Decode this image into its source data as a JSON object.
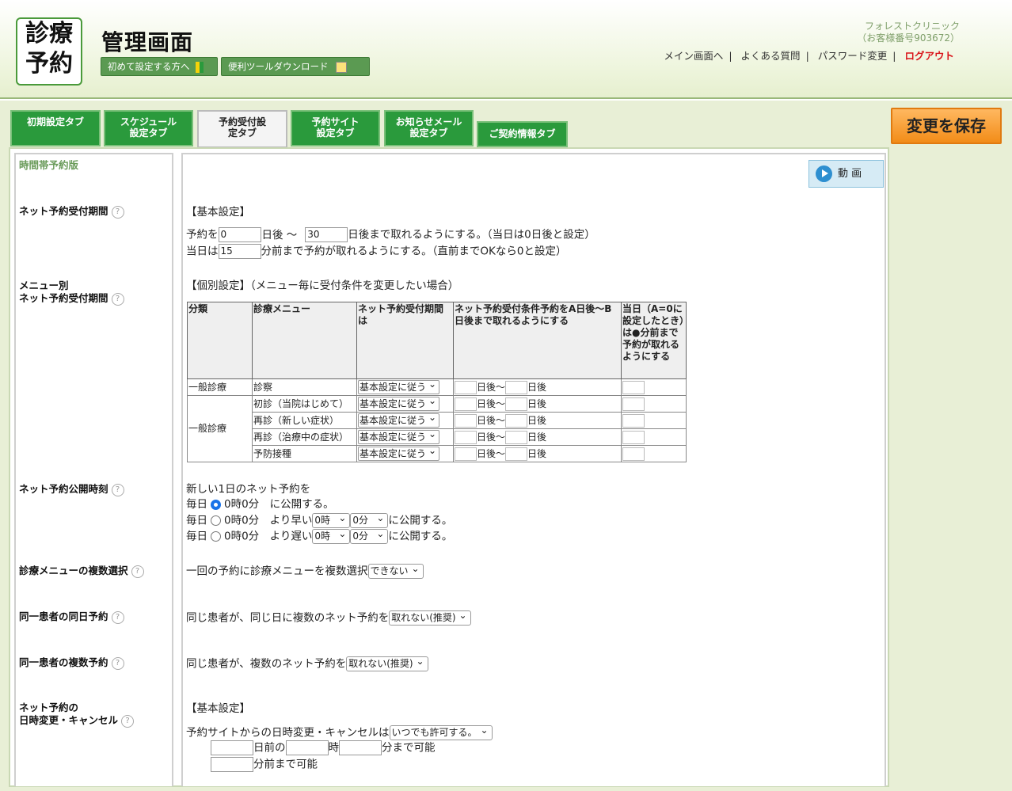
{
  "header": {
    "logo_text_1": "診療",
    "logo_text_2": "予約",
    "title": "管理画面",
    "btn_first": "初めて設定する方へ",
    "btn_tools": "便利ツールダウンロード",
    "clinic_name": "フォレストクリニック",
    "customer_no": "（お客様番号903672）",
    "link_main": "メイン画面へ",
    "link_faq": "よくある質問",
    "link_password": "パスワード変更",
    "link_logout": "ログアウト",
    "sep": "|"
  },
  "tabs": [
    {
      "label": "初期設定タブ"
    },
    {
      "label": "スケジュール設定タブ"
    },
    {
      "label": "予約受付設定タブ"
    },
    {
      "label": "予約サイト設定タブ"
    },
    {
      "label": "お知らせメール設定タブ"
    },
    {
      "label": "ご契約情報タブ"
    }
  ],
  "save_label": "変更を保存",
  "video_label": "動 画",
  "left": {
    "version": "時間帯予約版",
    "net_period": "ネット予約受付期間",
    "menu_period_1": "メニュー別",
    "menu_period_2": "ネット予約受付期間",
    "publish_time": "ネット予約公開時刻",
    "multi_menu": "診療メニューの複数選択",
    "same_day": "同一患者の同日予約",
    "multiple": "同一患者の複数予約",
    "change_1": "ネット予約の",
    "change_2": "日時変更・キャンセル",
    "help": "?"
  },
  "basic": {
    "heading": "【基本設定】",
    "l1_a": "予約を",
    "l1_v1": "0",
    "l1_b": "日後 ～",
    "l1_v2": "30",
    "l1_c": "日後まで取れるようにする。（当日は0日後と設定）",
    "l2_a": "当日は",
    "l2_v": "15",
    "l2_b": "分前まで予約が取れるようにする。（直前までOKなら0と設定）"
  },
  "individual": {
    "heading": "【個別設定】（メニュー毎に受付条件を変更したい場合）",
    "th1": "分類",
    "th2": "診療メニュー",
    "th3": "ネット予約受付期間は",
    "th4": "ネット予約受付条件予約をA日後～B日後まで取れるようにする",
    "th5": "当日（A=0に設定したとき）は●分前まで予約が取れるようにする",
    "rows": [
      {
        "cat": "一般診療",
        "menu": "診察",
        "sel": "基本設定に従う"
      },
      {
        "cat": "一般診療",
        "menu": "初診（当院はじめて）",
        "sel": "基本設定に従う"
      },
      {
        "cat": "",
        "menu": "再診（新しい症状）",
        "sel": "基本設定に従う"
      },
      {
        "cat": "",
        "menu": "再診（治療中の症状）",
        "sel": "基本設定に従う"
      },
      {
        "cat": "",
        "menu": "予防接種",
        "sel": "基本設定に従う"
      }
    ],
    "day_after": "日後～",
    "day_end": "日後"
  },
  "publish": {
    "line0": "新しい1日のネット予約を",
    "every": "毎日",
    "r1": "0時0分　に公開する。",
    "r2": "0時0分　より早い",
    "r3": "0時0分　より遅い",
    "hour": "0時",
    "min": "0分",
    "suffix": "に公開する。"
  },
  "multi_menu": {
    "text": "一回の予約に診療メニューを複数選択",
    "sel": "できない"
  },
  "same_day": {
    "text": "同じ患者が、同じ日に複数のネット予約を",
    "sel": "取れない(推奨)"
  },
  "multiple": {
    "text": "同じ患者が、複数のネット予約を",
    "sel": "取れない(推奨)"
  },
  "change": {
    "heading": "【基本設定】",
    "text": "予約サイトからの日時変更・キャンセルは",
    "sel": "いつでも許可する。",
    "l2_a": "日前の",
    "l2_b": "時",
    "l2_c": "分まで可能",
    "l3": "分前まで可能"
  }
}
